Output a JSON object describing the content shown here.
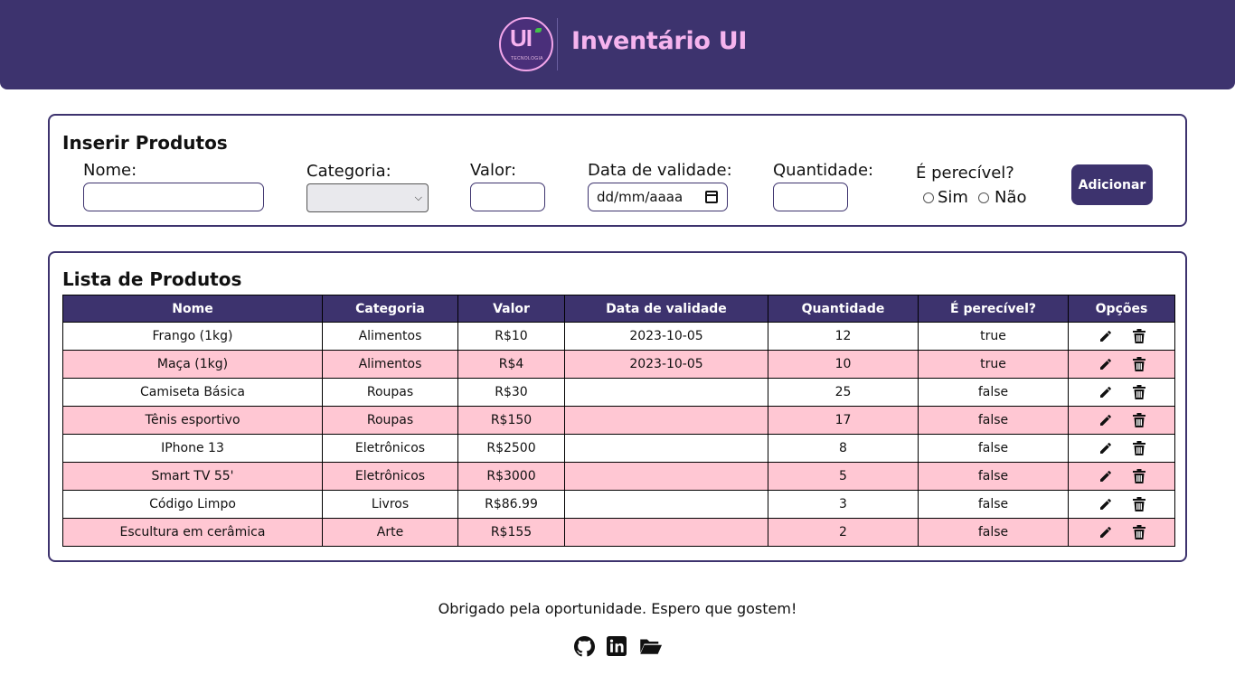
{
  "header": {
    "logo_main": "UI",
    "logo_sub": "TECNOLOGIA",
    "title": "Inventário UI"
  },
  "insert_form": {
    "title": "Inserir Produtos",
    "name_label": "Nome:",
    "name_value": "",
    "category_label": "Categoria:",
    "category_selected": "",
    "value_label": "Valor:",
    "value_value": "",
    "expiry_label": "Data de validade:",
    "expiry_placeholder": "dd/mm/aaaa",
    "quantity_label": "Quantidade:",
    "quantity_value": "",
    "perishable_label": "É perecível?",
    "yes_label": "Sim",
    "no_label": "Não",
    "add_button": "Adicionar"
  },
  "product_list": {
    "title": "Lista de Produtos",
    "columns": [
      "Nome",
      "Categoria",
      "Valor",
      "Data de validade",
      "Quantidade",
      "É perecível?",
      "Opções"
    ],
    "rows": [
      {
        "name": "Frango (1kg)",
        "category": "Alimentos",
        "value": "R$10",
        "expiry": "2023-10-05",
        "quantity": "12",
        "perishable": "true"
      },
      {
        "name": "Maça (1kg)",
        "category": "Alimentos",
        "value": "R$4",
        "expiry": "2023-10-05",
        "quantity": "10",
        "perishable": "true"
      },
      {
        "name": "Camiseta Básica",
        "category": "Roupas",
        "value": "R$30",
        "expiry": "",
        "quantity": "25",
        "perishable": "false"
      },
      {
        "name": "Tênis esportivo",
        "category": "Roupas",
        "value": "R$150",
        "expiry": "",
        "quantity": "17",
        "perishable": "false"
      },
      {
        "name": "IPhone 13",
        "category": "Eletrônicos",
        "value": "R$2500",
        "expiry": "",
        "quantity": "8",
        "perishable": "false"
      },
      {
        "name": "Smart TV 55'",
        "category": "Eletrônicos",
        "value": "R$3000",
        "expiry": "",
        "quantity": "5",
        "perishable": "false"
      },
      {
        "name": "Código Limpo",
        "category": "Livros",
        "value": "R$86.99",
        "expiry": "",
        "quantity": "3",
        "perishable": "false"
      },
      {
        "name": "Escultura em cerâmica",
        "category": "Arte",
        "value": "R$155",
        "expiry": "",
        "quantity": "2",
        "perishable": "false"
      }
    ],
    "row_icons": [
      "pencil-icon",
      "trash-icon"
    ]
  },
  "footer": {
    "message": "Obrigado pela oportunidade. Espero que gostem!",
    "icons": [
      "github-icon",
      "linkedin-icon",
      "folder-open-icon"
    ]
  },
  "colors": {
    "primary": "#3d336e",
    "accent_pink": "#f6b4ee",
    "row_stripe": "#ffc7d3"
  }
}
